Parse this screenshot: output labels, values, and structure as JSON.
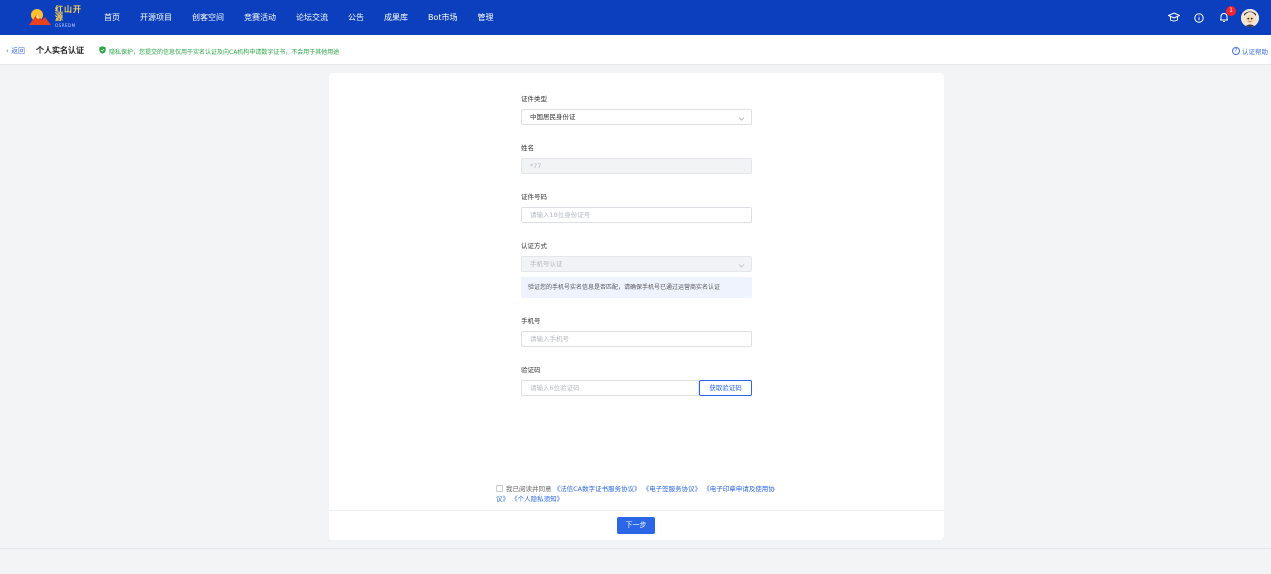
{
  "nav": {
    "logo_cn": "红山开源",
    "logo_en": "OSREDM",
    "items": [
      "首页",
      "开源项目",
      "创客空间",
      "竞赛活动",
      "论坛交流",
      "公告",
      "成果库",
      "Bot市场",
      "管理"
    ],
    "notification_count": "1",
    "brand_color": "#0b3fbd"
  },
  "subheader": {
    "back_label": "返回",
    "title": "个人实名认证",
    "privacy_text": "隐私保护，您提交的信息仅用于实名认证及向CA机构申请数字证书，不会用于其他用途",
    "help_label": "认证帮助"
  },
  "form": {
    "id_type_label": "证件类型",
    "id_type_value": "中国居民身份证",
    "name_label": "姓名",
    "name_value": "*77",
    "id_number_label": "证件号码",
    "id_number_placeholder": "请输入18位身份证号",
    "auth_method_label": "认证方式",
    "auth_method_value": "手机号认证",
    "auth_note": "验证您的手机号实名信息是否匹配，请确保手机号已通过运营商实名认证",
    "phone_label": "手机号",
    "phone_placeholder": "请输入手机号",
    "code_label": "验证码",
    "code_placeholder": "请输入6位验证码",
    "get_code_label": "获取验证码"
  },
  "agreement": {
    "prefix": "我已阅读并同意",
    "link1": "《法信CA数字证书服务协议》",
    "link2": "《电子签服务协议》",
    "link3": "《电子印章申请及使用协议》",
    "link4": "《个人隐私须知》"
  },
  "actions": {
    "next_label": "下一步",
    "primary_color": "#2a66e6"
  }
}
